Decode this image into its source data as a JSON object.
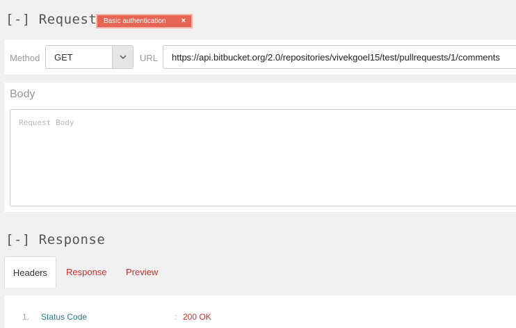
{
  "request": {
    "title": "[-] Request",
    "auth_badge": "Basic authentication",
    "auth_close": "×",
    "method_label": "Method",
    "method_value": "GET",
    "url_label": "URL",
    "url_value": "https://api.bitbucket.org/2.0/repositories/vivekgoel15/test/pullrequests/1/comments",
    "body_label": "Body",
    "body_placeholder": "Request Body"
  },
  "response": {
    "title": "[-] Response",
    "tabs": [
      {
        "label": "Headers",
        "active": true
      },
      {
        "label": "Response",
        "active": false
      },
      {
        "label": "Preview",
        "active": false
      }
    ],
    "headers": [
      {
        "index": "1.",
        "key": "Status Code",
        "separator": ":",
        "value": "200 OK"
      }
    ]
  },
  "icons": {
    "method_caret": "chevron-down-icon",
    "badge_close": "close-icon"
  },
  "colors": {
    "badge": "#e66454",
    "link_red": "#c9302c",
    "header_key": "#2e7d87"
  }
}
